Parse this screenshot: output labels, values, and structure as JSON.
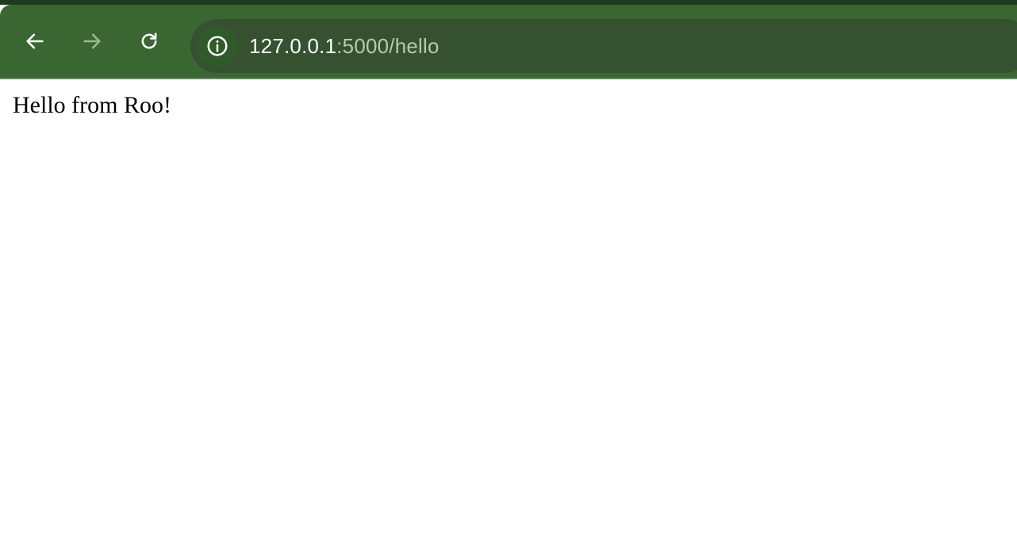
{
  "browser": {
    "back_icon": "arrow-left-icon",
    "forward_icon": "arrow-right-icon",
    "reload_icon": "reload-icon",
    "site_info_icon": "info-icon",
    "url_host": "127.0.0.1",
    "url_rest": ":5000/hello",
    "colors": {
      "toolbar": "#3a6632",
      "omnibox": "#35512f",
      "url_host": "#ffffff",
      "url_rest": "#b7c9b1"
    }
  },
  "page": {
    "body_text": "Hello from Roo!"
  }
}
